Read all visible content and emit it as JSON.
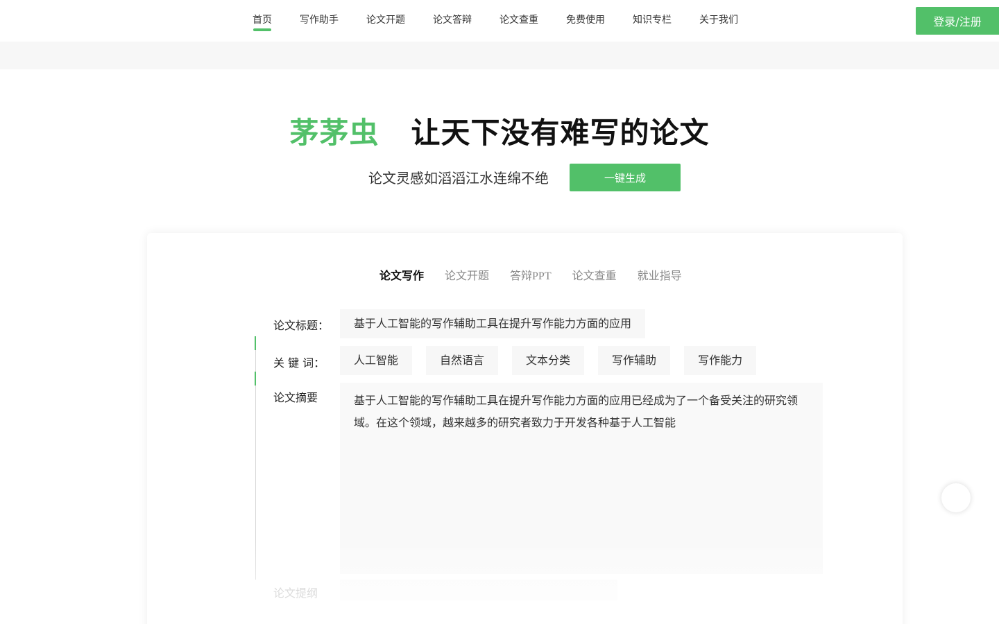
{
  "nav": {
    "items": [
      "首页",
      "写作助手",
      "论文开题",
      "论文答辩",
      "论文查重",
      "免费使用",
      "知识专栏",
      "关于我们"
    ],
    "active_index": 0,
    "login_label": "登录/注册"
  },
  "hero": {
    "brand": "茅茅虫",
    "slogan": "让天下没有难写的论文",
    "subtitle": "论文灵感如滔滔江水连绵不绝",
    "generate_label": "一键生成"
  },
  "card": {
    "tabs": [
      "论文写作",
      "论文开题",
      "答辩PPT",
      "论文查重",
      "就业指导"
    ],
    "active_tab": 0,
    "title_label": "论文标题：",
    "title_value": "基于人工智能的写作辅助工具在提升写作能力方面的应用",
    "keywords_label": "关 键 词：",
    "keywords": [
      "人工智能",
      "自然语言",
      "文本分类",
      "写作辅助",
      "写作能力"
    ],
    "abstract_label": "论文摘要",
    "abstract_text": "基于人工智能的写作辅助工具在提升写作能力方面的应用已经成为了一个备受关注的研究领域。在这个领域，越来越多的研究者致力于开发各种基于人工智能",
    "outline_label": "论文提纲"
  },
  "colors": {
    "accent": "#52c069",
    "panel": "#f7f7f7"
  }
}
